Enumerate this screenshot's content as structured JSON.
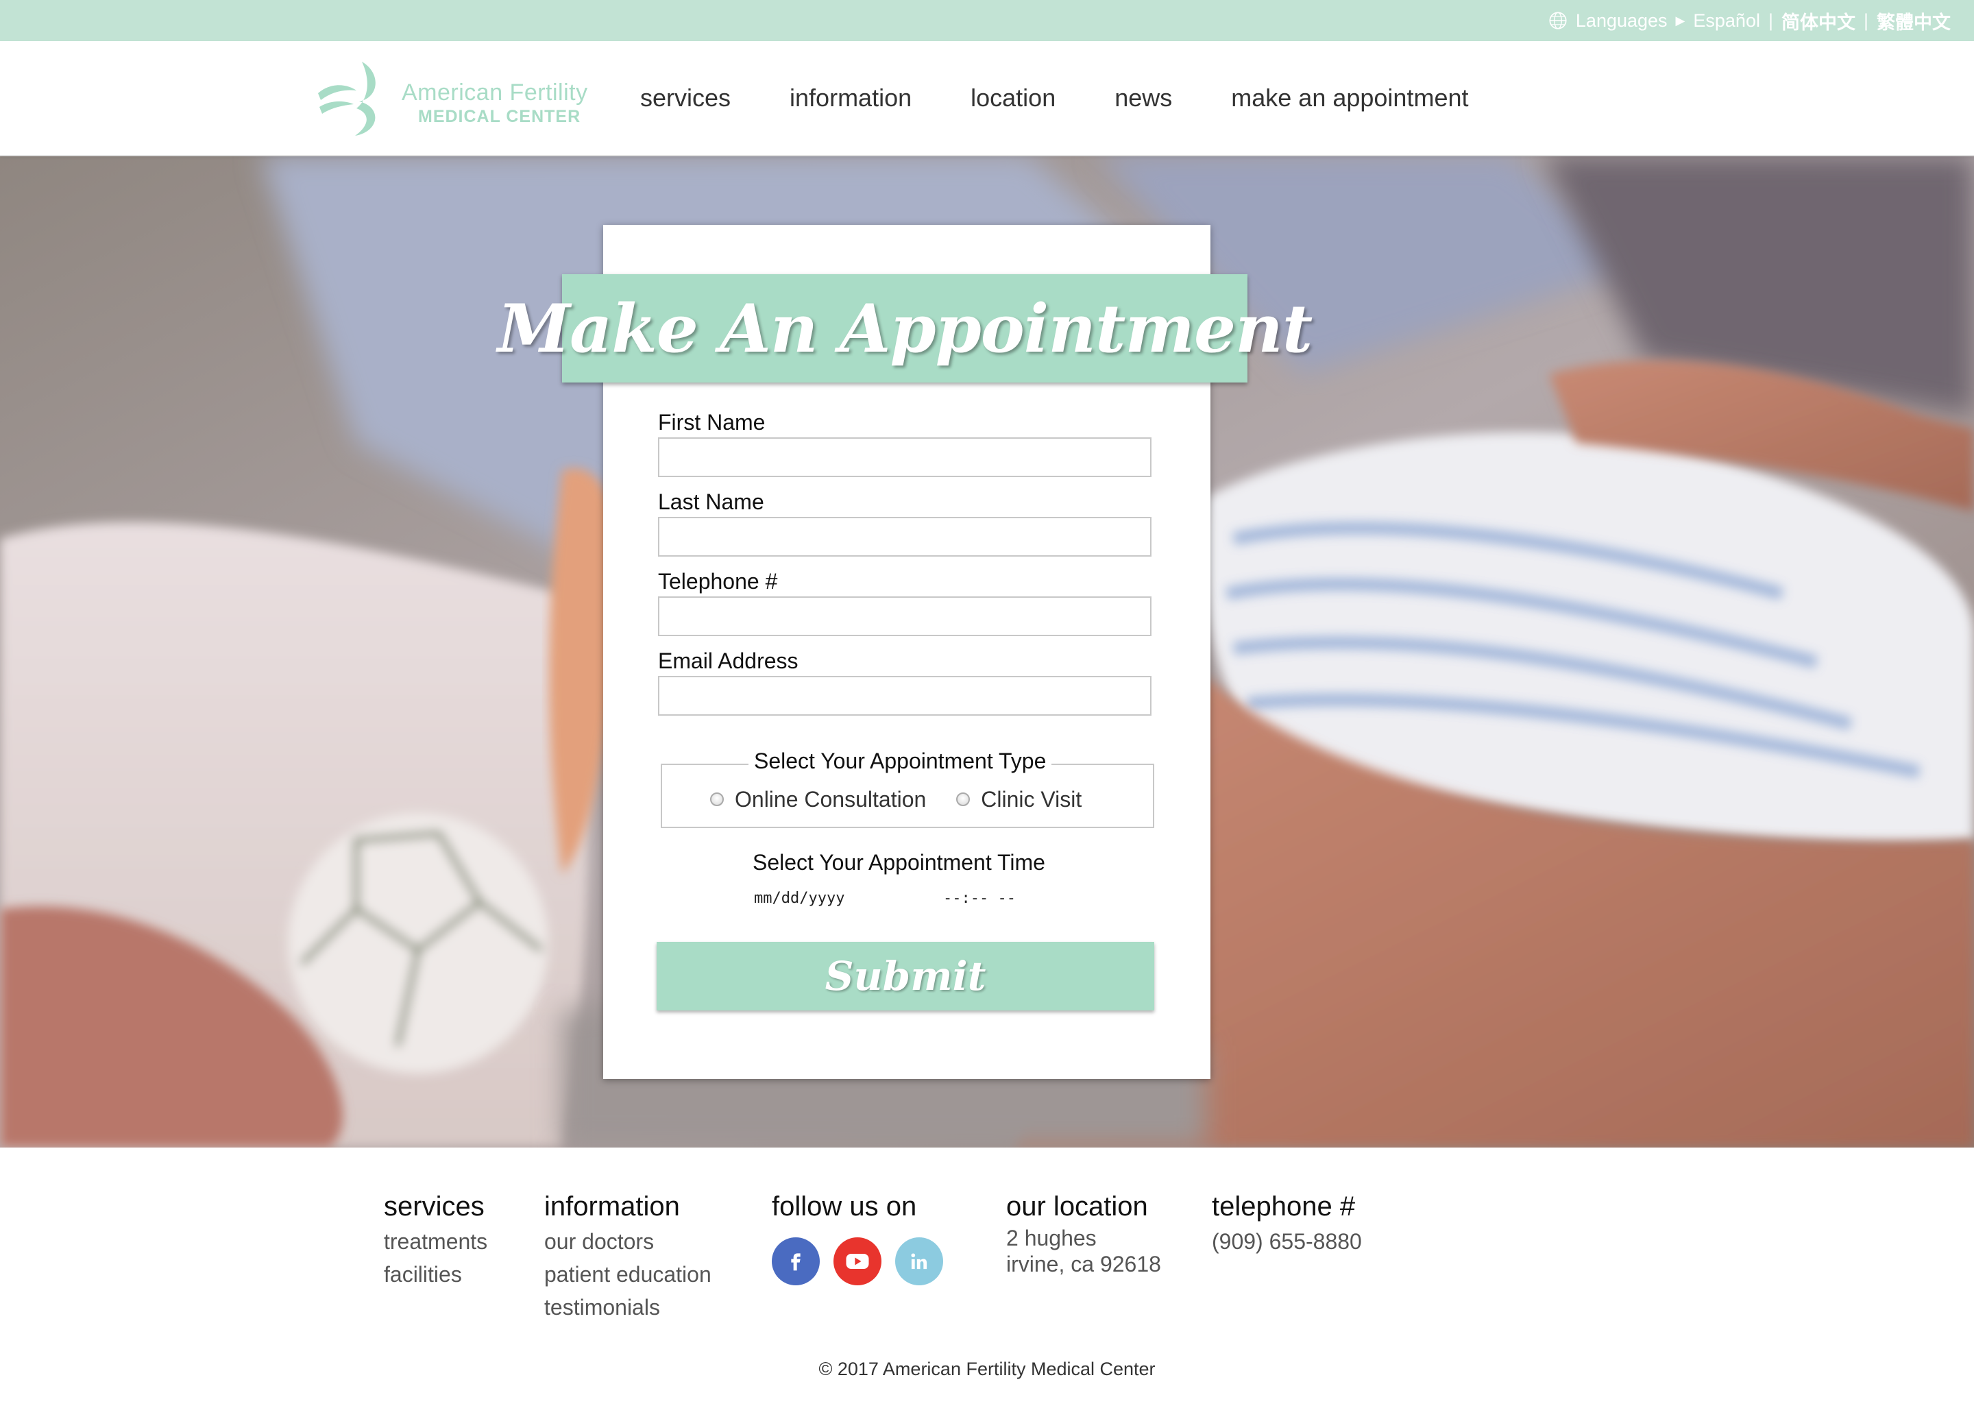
{
  "topbar": {
    "languages_label": "Languages",
    "lang_es": "Español",
    "lang_zh_simplified": "简体中文",
    "lang_zh_traditional": "繁體中文",
    "separator": "|"
  },
  "brand": {
    "line1": "American Fertility",
    "line2": "MEDICAL CENTER",
    "color": "#a8dcc6"
  },
  "nav": {
    "items": [
      "services",
      "information",
      "location",
      "news",
      "make an appointment"
    ]
  },
  "form": {
    "title": "Make An Appointment",
    "first_name_label": "First Name",
    "last_name_label": "Last Name",
    "telephone_label": "Telephone #",
    "email_label": "Email Address",
    "appointment_type_legend": "Select Your Appointment Type",
    "type_online": "Online Consultation",
    "type_clinic": "Clinic Visit",
    "appointment_time_label": "Select Your Appointment Time",
    "date_placeholder": "mm/dd/yyyy",
    "time_placeholder": "--:-- --",
    "submit_label": "Submit"
  },
  "footer": {
    "services": {
      "heading": "services",
      "links": [
        "treatments",
        "facilities"
      ]
    },
    "information": {
      "heading": "information",
      "links": [
        "our doctors",
        "patient education",
        "testimonials"
      ]
    },
    "follow": {
      "heading": "follow us on",
      "icons": [
        "facebook-icon",
        "youtube-icon",
        "linkedin-icon"
      ]
    },
    "location": {
      "heading": "our location",
      "line1": "2 hughes",
      "line2": "irvine, ca 92618"
    },
    "telephone": {
      "heading": "telephone #",
      "number": "(909) 655-8880"
    },
    "copyright": "© 2017 American Fertility Medical Center"
  },
  "colors": {
    "accent": "#a9dcc6",
    "topbar": "#c2e3d4",
    "facebook": "#4a6bc1",
    "youtube": "#e8342d",
    "linkedin": "#8ccbe0"
  }
}
